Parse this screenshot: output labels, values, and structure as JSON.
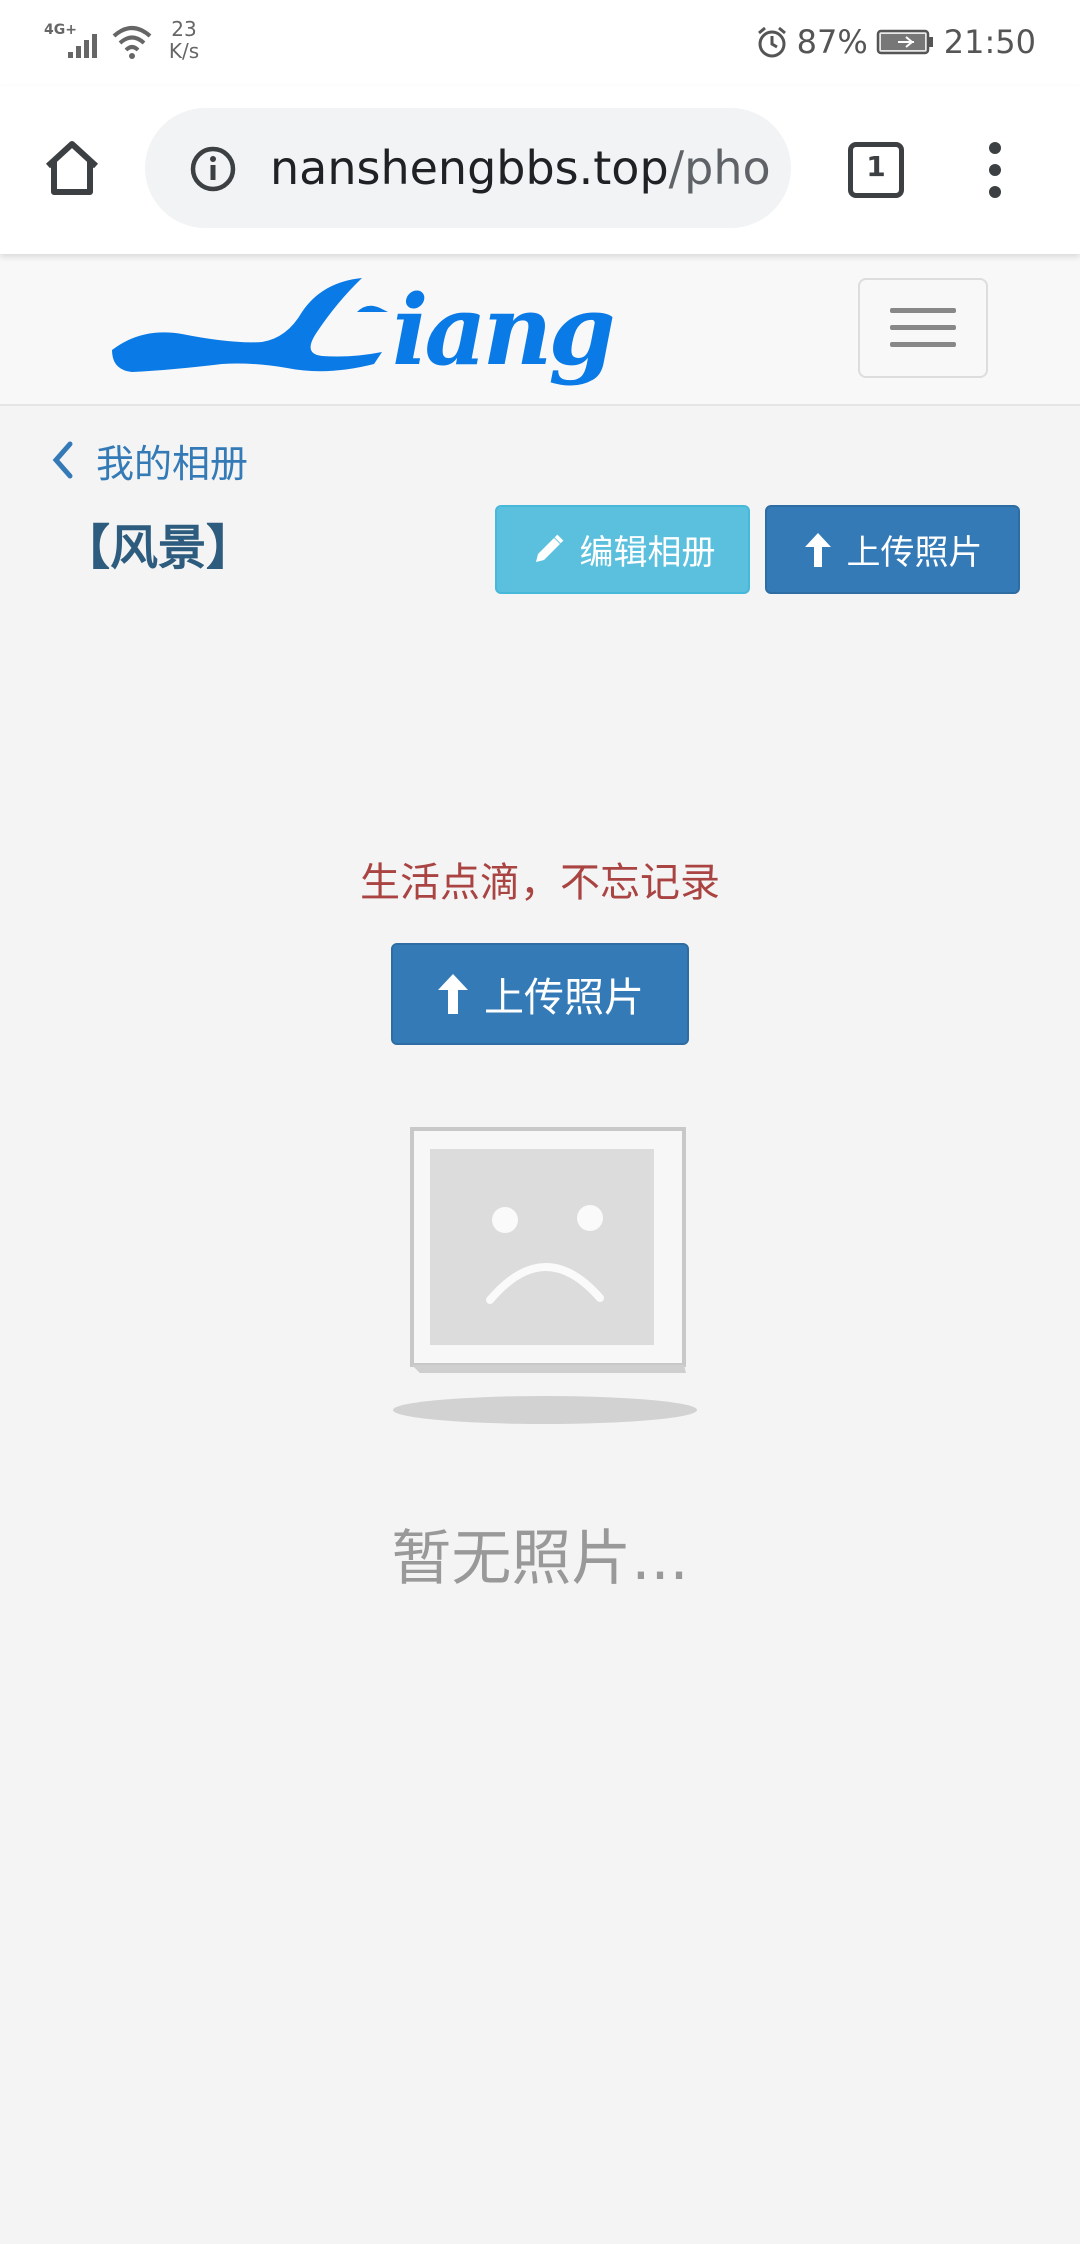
{
  "status_bar": {
    "network": "4G+",
    "speed_value": "23",
    "speed_unit": "K/s",
    "battery": "87%",
    "time": "21:50",
    "icons": [
      "signal-icon",
      "wifi-icon",
      "alarm-icon",
      "battery-icon"
    ]
  },
  "browser": {
    "url_host": "nanshengbbs.top",
    "url_path": "/photo",
    "tab_count": "1",
    "icons": [
      "home-icon",
      "info-icon",
      "tabs-icon",
      "more-menu-icon"
    ]
  },
  "site": {
    "logo_text": "Liang",
    "menu_icon": "hamburger-icon",
    "brand_color": "#0a7ae6"
  },
  "page": {
    "back_label": "我的相册",
    "album_title": "【风景】",
    "edit_button": "编辑相册",
    "upload_button": "上传照片",
    "tagline": "生活点滴，不忘记录",
    "upload_main_button": "上传照片",
    "empty_text": "暂无照片..."
  },
  "colors": {
    "primary": "#337ab7",
    "info": "#5bc0de",
    "danger_text": "#a94442",
    "page_bg": "#f4f4f4"
  }
}
